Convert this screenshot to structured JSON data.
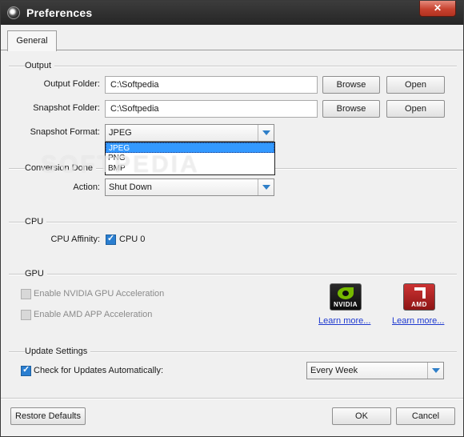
{
  "window": {
    "title": "Preferences",
    "close_glyph": "✕"
  },
  "tabs": [
    {
      "label": "General"
    }
  ],
  "output": {
    "section_label": "Output",
    "output_folder": {
      "label": "Output Folder:",
      "value": "C:\\Softpedia",
      "browse": "Browse",
      "open": "Open"
    },
    "snapshot_folder": {
      "label": "Snapshot Folder:",
      "value": "C:\\Softpedia",
      "browse": "Browse",
      "open": "Open"
    },
    "snapshot_format": {
      "label": "Snapshot Format:",
      "value": "JPEG",
      "options": [
        "JPEG",
        "PNG",
        "BMP"
      ]
    }
  },
  "conversion_done": {
    "section_label": "Conversion Done",
    "action_label": "Action:",
    "action_value": "Shut Down"
  },
  "cpu": {
    "section_label": "CPU",
    "affinity_label": "CPU Affinity:",
    "cpu0_label": "CPU 0",
    "cpu0_checked": true
  },
  "gpu": {
    "section_label": "GPU",
    "nvidia_label": "Enable NVIDIA GPU Acceleration",
    "amd_label": "Enable AMD APP Acceleration",
    "nvidia_enabled": false,
    "amd_enabled": false,
    "nvidia_logo_text": "NVIDIA",
    "amd_logo_text": "AMD",
    "nvidia_learn_more": "Learn more...",
    "amd_learn_more": "Learn more..."
  },
  "updates": {
    "section_label": "Update Settings",
    "check_label": "Check for Updates Automatically:",
    "check_checked": true,
    "frequency": "Every Week"
  },
  "footer": {
    "restore_defaults": "Restore Defaults",
    "ok": "OK",
    "cancel": "Cancel"
  },
  "watermark": "SOFTPEDIA",
  "colors": {
    "titlebar": "#2e2e2e",
    "close": "#c7422f",
    "accent": "#2a7ed0",
    "selection": "#3399ff",
    "link": "#1f3ad0"
  }
}
